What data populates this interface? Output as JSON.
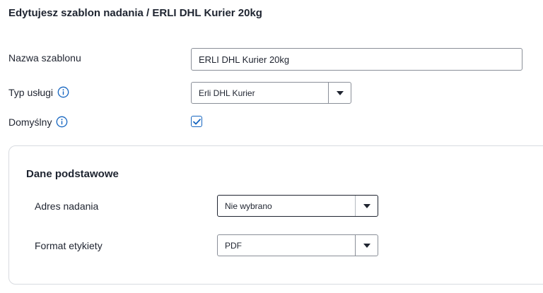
{
  "page": {
    "title": "Edytujesz szablon nadania / ERLI DHL Kurier 20kg"
  },
  "form": {
    "template_name": {
      "label": "Nazwa szablonu",
      "value": "ERLI DHL Kurier 20kg"
    },
    "service_type": {
      "label": "Typ usługi",
      "selected": "Erli DHL Kurier",
      "info_icon": "info-circle-icon"
    },
    "default": {
      "label": "Domyślny",
      "checked": true,
      "info_icon": "info-circle-icon"
    }
  },
  "basic_section": {
    "title": "Dane podstawowe",
    "sender_address": {
      "label": "Adres nadania",
      "selected": "Nie wybrano"
    },
    "label_format": {
      "label": "Format etykiety",
      "selected": "PDF"
    }
  },
  "colors": {
    "accent": "#1565c0",
    "border": "#8a8f98",
    "text": "#1f2430"
  }
}
